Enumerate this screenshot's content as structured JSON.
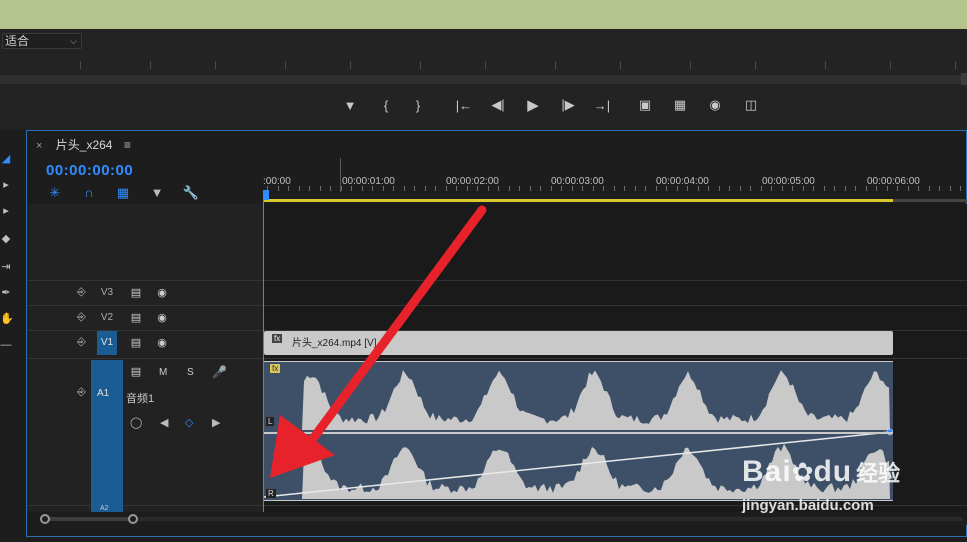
{
  "monitor": {
    "fit_label": "适合",
    "transport_buttons": [
      "add-marker",
      "mark-in",
      "mark-out",
      "go-to-in",
      "step-back",
      "play",
      "step-forward",
      "go-to-out",
      "lift",
      "extract",
      "export-frame",
      "button-editor"
    ]
  },
  "sequence": {
    "tab_label": "片头_x264",
    "timecode": "00:00:00:00"
  },
  "ruler": {
    "labels": [
      ":00:00",
      "00:00:01:00",
      "00:00:02:00",
      "00:00:03:00",
      "00:00:04:00",
      "00:00:05:00",
      "00:00:06:00"
    ]
  },
  "tracks": {
    "video": [
      {
        "id": "V3",
        "label": "V3",
        "targeted": false
      },
      {
        "id": "V2",
        "label": "V2",
        "targeted": false
      },
      {
        "id": "V1",
        "label": "V1",
        "targeted": true
      }
    ],
    "audio": {
      "label": "A1",
      "name": "音频1",
      "mute_label": "M",
      "solo_label": "S",
      "next_label": "A2"
    }
  },
  "clips": {
    "video_clip_name": "片头_x264.mp4 [V]",
    "fx_label": "fx",
    "audio_fx_label": "fx",
    "left_channel": "L",
    "right_channel": "R"
  },
  "watermark": {
    "brand": "Bai",
    "brand2": "du",
    "sub": "经验",
    "url": "jingyan.baidu.com"
  },
  "colors": {
    "accent": "#2f8dff",
    "work_area": "#d9c92a",
    "audio_clip": "#3d5068",
    "video_clip": "#c9c9c9",
    "arrow": "#e8222b"
  }
}
